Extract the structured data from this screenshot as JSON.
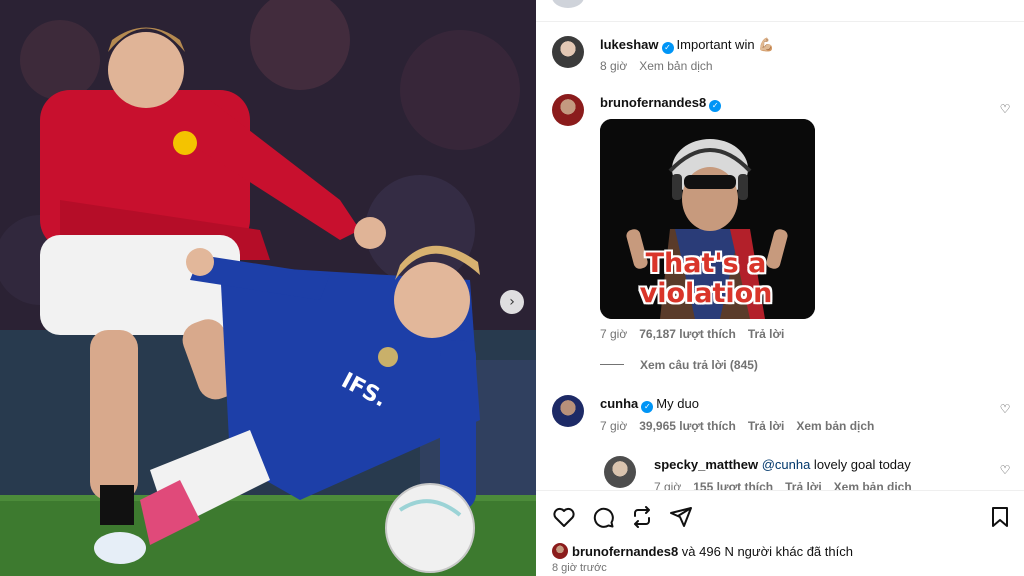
{
  "post": {
    "image_alt": "Football players",
    "next_arrow": "›"
  },
  "comments": [
    {
      "username": "lukeshaw",
      "verified": "✓",
      "text": "Important win 💪🏼",
      "time": "8 giờ",
      "translate": "Xem bản dịch"
    },
    {
      "username": "brunofernandes8",
      "verified": "✓",
      "gif_text_line1": "That's a",
      "gif_text_line2": "violation",
      "time": "7 giờ",
      "likes": "76,187 lượt thích",
      "reply": "Trả lời",
      "view_replies": "Xem câu trả lời (845)"
    },
    {
      "username": "cunha",
      "verified": "✓",
      "text": "My duo",
      "time": "7 giờ",
      "likes": "39,965 lượt thích",
      "reply": "Trả lời",
      "translate": "Xem bản dịch"
    },
    {
      "username": "specky_matthew",
      "mention": "@cunha",
      "text": " lovely goal today",
      "time": "7 giờ",
      "likes": "155 lượt thích",
      "reply": "Trả lời",
      "translate": "Xem bản dịch"
    }
  ],
  "actions": {
    "icons": [
      "heart-icon",
      "comment-icon",
      "repost-icon",
      "share-icon",
      "bookmark-icon"
    ],
    "liked_by_user": "brunofernandes8",
    "liked_by_rest": " và 496 N người khác đã thích",
    "time_ago": "8 giờ trước"
  },
  "colors": {
    "verified": "#0095f6",
    "meta": "#737373",
    "united_red": "#c8102e",
    "chelsea_blue": "#1d3fa8"
  }
}
